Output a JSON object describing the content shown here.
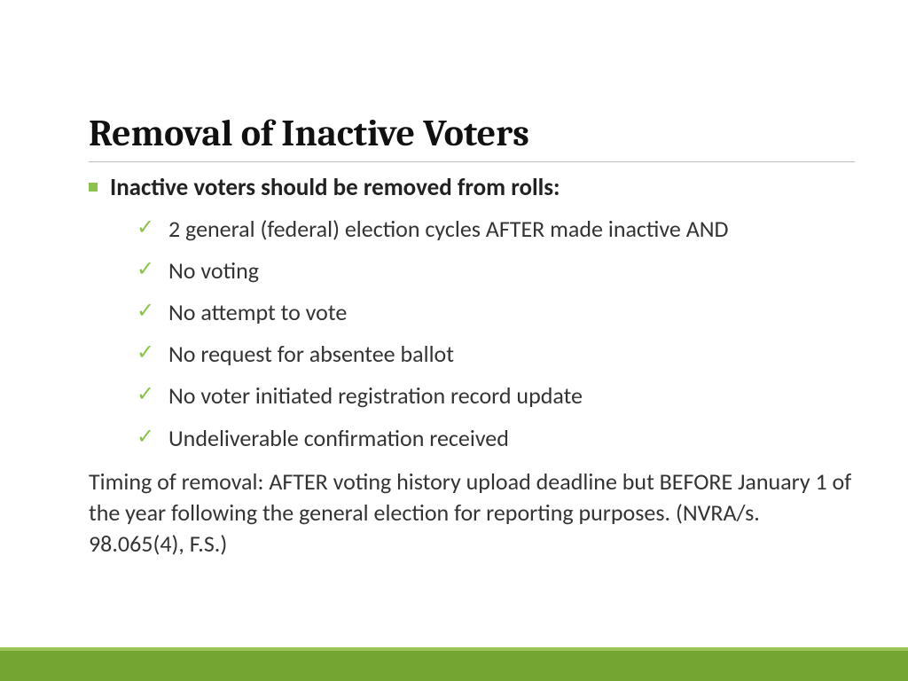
{
  "title": "Removal of Inactive Voters",
  "lead": "Inactive voters should be removed from rolls:",
  "checks": [
    "2 general (federal) election cycles AFTER made inactive AND",
    "No voting",
    "No attempt to vote",
    "No request for absentee ballot",
    "No voter initiated registration record update",
    "Undeliverable confirmation received"
  ],
  "para": "Timing of removal: AFTER voting history upload deadline but BEFORE January 1 of the year following the general election for reporting purposes.  (NVRA/s. 98.065(4), F.S.)"
}
